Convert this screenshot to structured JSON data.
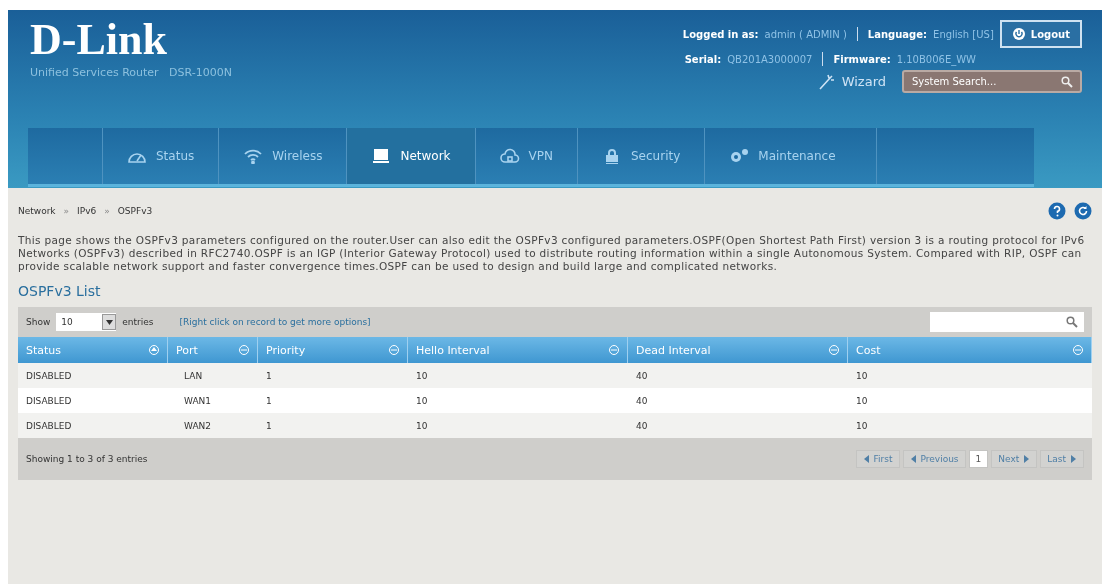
{
  "header": {
    "logo": "D-Link",
    "subtitle": "Unified Services Router   DSR-1000N",
    "logged_in_label": "Logged in as:",
    "logged_in_value": "admin ( ADMIN )",
    "language_label": "Language:",
    "language_value": "English [US]",
    "logout": "Logout",
    "serial_label": "Serial:",
    "serial_value": "QB201A3000007",
    "firmware_label": "Firmware:",
    "firmware_value": "1.10B006E_WW",
    "wizard": "Wizard",
    "search_placeholder": "System Search..."
  },
  "nav": [
    {
      "label": "Status",
      "kind": "gauge",
      "selected": false
    },
    {
      "label": "Wireless",
      "kind": "wifi",
      "selected": false
    },
    {
      "label": "Network",
      "kind": "network",
      "selected": true
    },
    {
      "label": "VPN",
      "kind": "cloud",
      "selected": false
    },
    {
      "label": "Security",
      "kind": "lock",
      "selected": false
    },
    {
      "label": "Maintenance",
      "kind": "gears",
      "selected": false
    }
  ],
  "breadcrumb": [
    {
      "label": "Network"
    },
    {
      "separator": "»",
      "label": "IPv6"
    },
    {
      "separator": "»",
      "label": "OSPFv3"
    }
  ],
  "description": "This page shows the OSPFv3 parameters configured on the router.User can also edit the OSPFv3 configured parameters.OSPF(Open Shortest Path First) version 3 is a routing protocol for IPv6 Networks (OSPFv3) described in RFC2740.OSPF is an IGP (Interior Gateway Protocol) used to distribute routing information within a single Autonomous System. Compared with RIP, OSPF can provide scalable network support and faster convergence times.OSPF can be used to design and build large and complicated networks.",
  "section_title": "OSPFv3 List",
  "toolbar": {
    "show_label": "Show",
    "page_size": "10",
    "entries_label": "entries",
    "hint": "[Right click on record to get more options]"
  },
  "table": {
    "columns": [
      {
        "label": "Status",
        "sorted": true
      },
      {
        "label": "Port",
        "sorted": false
      },
      {
        "label": "Priority",
        "sorted": false
      },
      {
        "label": "Hello Interval",
        "sorted": false
      },
      {
        "label": "Dead Interval",
        "sorted": false
      },
      {
        "label": "Cost",
        "sorted": false
      }
    ],
    "rows": [
      [
        "DISABLED",
        "LAN",
        "1",
        "10",
        "40",
        "10"
      ],
      [
        "DISABLED",
        "WAN1",
        "1",
        "10",
        "40",
        "10"
      ],
      [
        "DISABLED",
        "WAN2",
        "1",
        "10",
        "40",
        "10"
      ]
    ]
  },
  "footer": {
    "summary": "Showing 1 to 3 of 3 entries",
    "pages": [
      {
        "label": "First",
        "kind": "first",
        "disabled": true
      },
      {
        "label": "Previous",
        "kind": "prev",
        "disabled": true
      },
      {
        "label": "1",
        "kind": "page",
        "disabled": false
      },
      {
        "label": "Next",
        "kind": "next",
        "disabled": true
      },
      {
        "label": "Last",
        "kind": "last",
        "disabled": true
      }
    ]
  }
}
